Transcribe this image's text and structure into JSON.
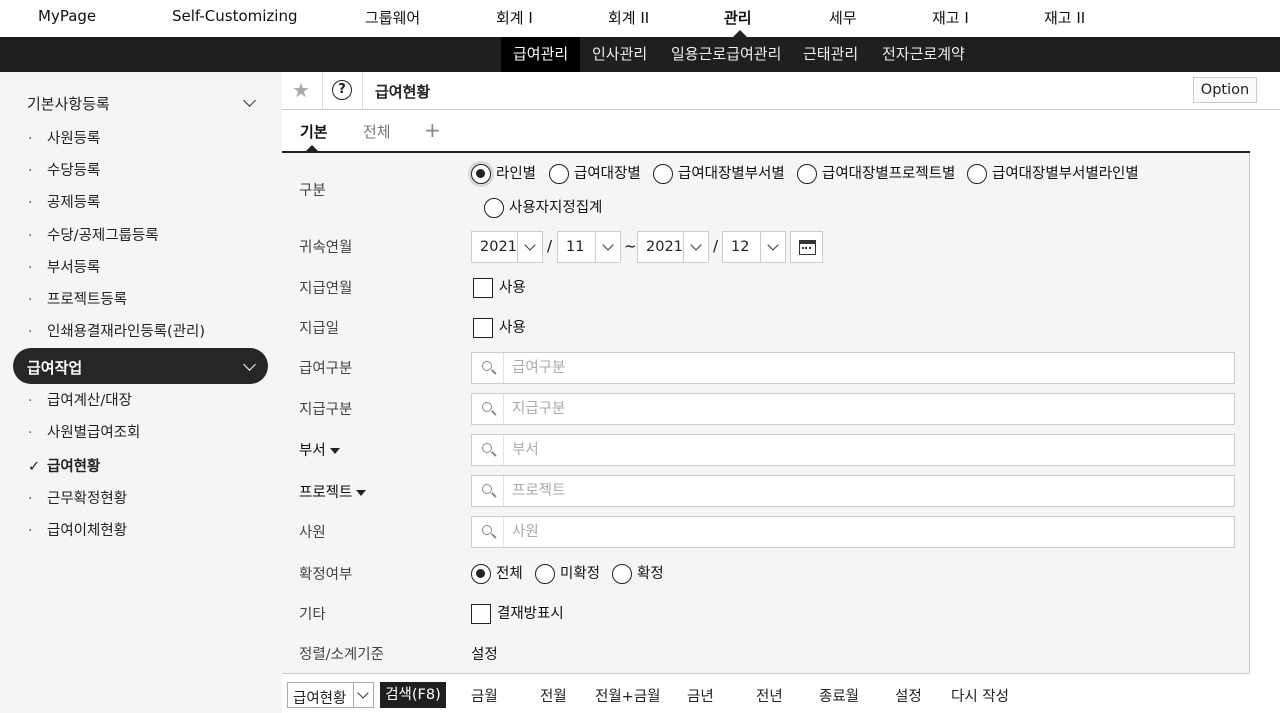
{
  "topnav": {
    "items": [
      "MyPage",
      "Self-Customizing",
      "그룹웨어",
      "회계 I",
      "회계 II",
      "관리",
      "세무",
      "재고 I",
      "재고 II"
    ],
    "active": "관리"
  },
  "subnav": {
    "items": [
      "급여관리",
      "인사관리",
      "일용근로급여관리",
      "근태관리",
      "전자근로계약"
    ],
    "active": "급여관리"
  },
  "sidebar": {
    "group1": "기본사항등록",
    "group1_items": [
      "사원등록",
      "수당등록",
      "공제등록",
      "수당/공제그룹등록",
      "부서등록",
      "프로젝트등록",
      "인쇄용결재라인등록(관리)"
    ],
    "group2": "급여작업",
    "group2_items": [
      "급여계산/대장",
      "사원별급여조회",
      "급여현황",
      "근무확정현황",
      "급여이체현황"
    ],
    "current": "급여현황"
  },
  "header": {
    "title": "급여현황",
    "help": "?",
    "option": "Option"
  },
  "tabs": {
    "items": [
      "기본",
      "전체"
    ],
    "active": "기본",
    "add": "+"
  },
  "form": {
    "gubun": {
      "label": "구분",
      "options": [
        "라인별",
        "급여대장별",
        "급여대장별부서별",
        "급여대장별프로젝트별",
        "급여대장별부서별라인별",
        "사용자지정집계"
      ],
      "selected": "라인별"
    },
    "period": {
      "label": "귀속연월",
      "from_year": "2021",
      "from_month": "11",
      "to_year": "2021",
      "to_month": "12",
      "slash": "/",
      "tilde": "~"
    },
    "pay_month": {
      "label": "지급연월",
      "checkbox": "사용",
      "checked": false
    },
    "pay_day": {
      "label": "지급일",
      "checkbox": "사용",
      "checked": false
    },
    "pay_type": {
      "label": "급여구분",
      "placeholder": "급여구분"
    },
    "pay_kind": {
      "label": "지급구분",
      "placeholder": "지급구분"
    },
    "dept": {
      "label": "부서",
      "placeholder": "부서"
    },
    "project": {
      "label": "프로젝트",
      "placeholder": "프로젝트"
    },
    "employee": {
      "label": "사원",
      "placeholder": "사원"
    },
    "confirm": {
      "label": "확정여부",
      "options": [
        "전체",
        "미확정",
        "확정"
      ],
      "selected": "전체"
    },
    "etc": {
      "label": "기타",
      "checkbox": "결재방표시",
      "checked": false
    },
    "sort": {
      "label": "정렬/소계기준",
      "value": "설정"
    }
  },
  "footer": {
    "report_select": "급여현황",
    "search": "검색(F8)",
    "buttons": [
      "금월",
      "전월",
      "전월+금월",
      "금년",
      "전년",
      "종료월",
      "설정",
      "다시 작성"
    ]
  }
}
